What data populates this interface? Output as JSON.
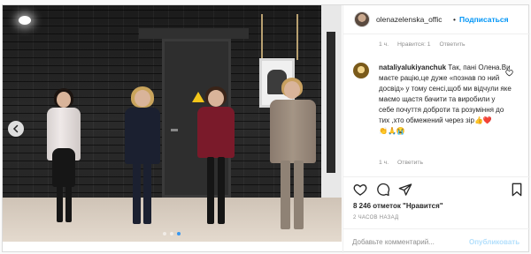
{
  "header": {
    "username": "olenazelenska_offic",
    "separator": "•",
    "follow_label": "Подписаться"
  },
  "comments": {
    "prev_meta": {
      "time": "1 ч.",
      "likes": "Нравится: 1",
      "reply": "Ответить"
    },
    "items": [
      {
        "username": "nataliyalukiyanchuk",
        "text": "Так, пані Олена.Ви маєте рацію,це дуже «познав по ний досвід» у тому сенсі,щоб ми відчули яке маємо щастя бачити та виробили у себе почуття доброти та розуміння до тих ,хто обмежений через зір",
        "emoji_end": "👍❤️",
        "emoji_line": "👏🙏😭",
        "time": "1 ч.",
        "reply": "Ответить"
      }
    ]
  },
  "actions": {
    "icons": [
      "heart-icon",
      "comment-icon",
      "share-icon",
      "bookmark-icon"
    ]
  },
  "likes": {
    "count": "8 246",
    "suffix": "отметок \"Нравится\""
  },
  "time_ago": "2 ЧАСОВ НАЗАД",
  "add_comment": {
    "placeholder": "Добавьте комментарий...",
    "publish_label": "Опубликовать"
  },
  "carousel": {
    "slides": 3,
    "active_index": 2
  },
  "colors": {
    "accent": "#0095f6",
    "publish_disabled": "#b2dffc",
    "like_red": "#ed4956"
  }
}
